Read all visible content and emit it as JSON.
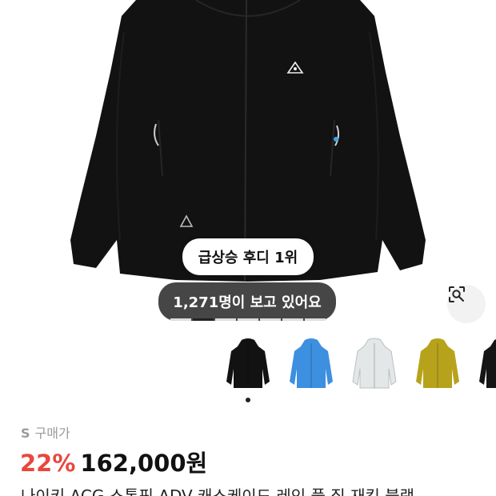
{
  "product": {
    "image_alt": "black hooded jacket with ACG logo",
    "rank_badge": "급상승 후디 1위",
    "viewers_text": "1,271명이 보고 있어요",
    "progress": {
      "total_segments": 7,
      "active_index": 1
    },
    "thumbnails": [
      {
        "color_name": "black",
        "color": "#121212"
      },
      {
        "color_name": "blue",
        "color": "#3d8fe0"
      },
      {
        "color_name": "light-gray",
        "color": "#e3e7e8"
      },
      {
        "color_name": "olive-yellow",
        "color": "#b7a21c"
      },
      {
        "color_name": "black",
        "color": "#151515"
      }
    ],
    "selected_thumbnail": 0,
    "price_label_prefix": "S",
    "price_label": "구매가",
    "discount": "22%",
    "price": "162,000원",
    "title_partial": "나이키 ACG 스톰핏 ADV 캐스케이드 레인 풀 집 재킷 블랙"
  },
  "icons": {
    "lens": "image-search-icon"
  },
  "colors": {
    "discount": "#e8483e",
    "text": "#111111",
    "muted": "#9a9a9a"
  }
}
